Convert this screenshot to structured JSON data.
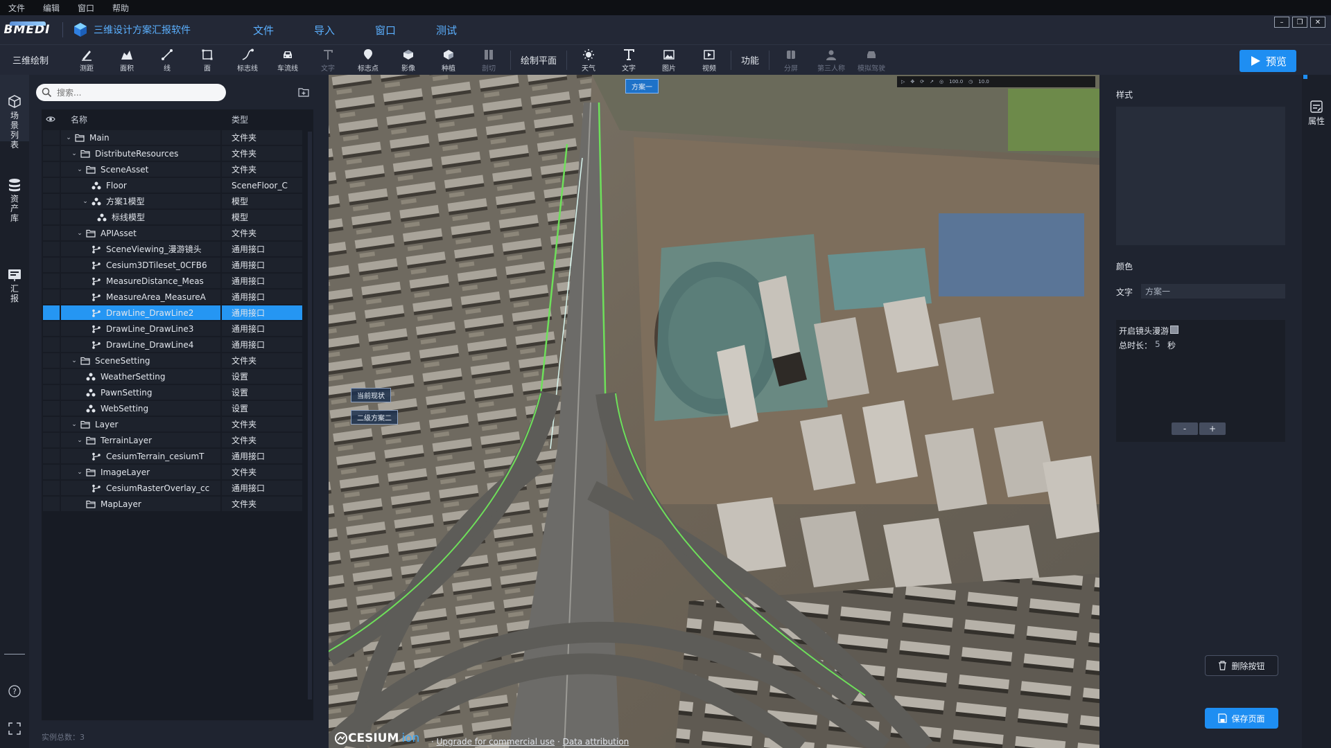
{
  "menubar": {
    "items": [
      "文件",
      "编辑",
      "窗口",
      "帮助"
    ]
  },
  "titlebar": {
    "logo": "BMEDI",
    "app_title": "三维设计方案汇报软件",
    "menus": [
      "文件",
      "导入",
      "窗口",
      "测试"
    ]
  },
  "toolbar": {
    "section_title": "三维绘制",
    "tools": [
      {
        "label": "测距",
        "icon": "ruler-icon",
        "enabled": true
      },
      {
        "label": "面积",
        "icon": "area-icon",
        "enabled": true
      },
      {
        "label": "线",
        "icon": "line-icon",
        "enabled": true
      },
      {
        "label": "面",
        "icon": "polygon-icon",
        "enabled": true
      },
      {
        "label": "标志线",
        "icon": "marker-line-icon",
        "enabled": true
      },
      {
        "label": "车流线",
        "icon": "car-icon",
        "enabled": true
      },
      {
        "label": "文字",
        "icon": "text-icon",
        "enabled": false
      },
      {
        "label": "标志点",
        "icon": "pin-icon",
        "enabled": true
      },
      {
        "label": "影像",
        "icon": "image-layer-icon",
        "enabled": true
      },
      {
        "label": "种植",
        "icon": "plant-icon",
        "enabled": true
      },
      {
        "label": "剖切",
        "icon": "section-icon",
        "enabled": false
      }
    ],
    "plane_label": "绘制平面",
    "tools2": [
      {
        "label": "天气",
        "icon": "weather-icon",
        "enabled": true
      },
      {
        "label": "文字",
        "icon": "text-icon",
        "enabled": true
      },
      {
        "label": "图片",
        "icon": "picture-icon",
        "enabled": true
      },
      {
        "label": "视频",
        "icon": "video-icon",
        "enabled": true
      }
    ],
    "function_label": "功能",
    "tools3": [
      {
        "label": "分屏",
        "icon": "split-screen-icon",
        "enabled": false
      },
      {
        "label": "第三人称",
        "icon": "person-icon",
        "enabled": false
      },
      {
        "label": "模拟驾驶",
        "icon": "drive-icon",
        "enabled": false
      }
    ],
    "preview_label": "预览"
  },
  "leftrail": {
    "items": [
      {
        "label": "场景列表",
        "icon": "scene-list-icon"
      },
      {
        "label": "资产库",
        "icon": "asset-library-icon"
      },
      {
        "label": "汇报",
        "icon": "report-icon"
      }
    ]
  },
  "tree": {
    "search_placeholder": "搜索...",
    "col_name": "名称",
    "col_type": "类型",
    "rows": [
      {
        "name": "Main",
        "type": "文件夹",
        "depth": 0,
        "kind": "folder",
        "expanded": true
      },
      {
        "name": "DistributeResources",
        "type": "文件夹",
        "depth": 1,
        "kind": "folder",
        "expanded": true
      },
      {
        "name": "SceneAsset",
        "type": "文件夹",
        "depth": 2,
        "kind": "folder",
        "expanded": true
      },
      {
        "name": "Floor",
        "type": "SceneFloor_C",
        "depth": 3,
        "kind": "model"
      },
      {
        "name": "方案1模型",
        "type": "模型",
        "depth": 3,
        "kind": "model",
        "expanded": true
      },
      {
        "name": "标线模型",
        "type": "模型",
        "depth": 4,
        "kind": "model"
      },
      {
        "name": "APIAsset",
        "type": "文件夹",
        "depth": 2,
        "kind": "folder",
        "expanded": true
      },
      {
        "name": "SceneViewing_漫游镜头",
        "type": "通用接口",
        "depth": 3,
        "kind": "api"
      },
      {
        "name": "Cesium3DTileset_0CFB6",
        "type": "通用接口",
        "depth": 3,
        "kind": "api"
      },
      {
        "name": "MeasureDistance_Meas",
        "type": "通用接口",
        "depth": 3,
        "kind": "api"
      },
      {
        "name": "MeasureArea_MeasureA",
        "type": "通用接口",
        "depth": 3,
        "kind": "api"
      },
      {
        "name": "DrawLine_DrawLine2",
        "type": "通用接口",
        "depth": 3,
        "kind": "api",
        "selected": true
      },
      {
        "name": "DrawLine_DrawLine3",
        "type": "通用接口",
        "depth": 3,
        "kind": "api"
      },
      {
        "name": "DrawLine_DrawLine4",
        "type": "通用接口",
        "depth": 3,
        "kind": "api"
      },
      {
        "name": "SceneSetting",
        "type": "文件夹",
        "depth": 1,
        "kind": "folder",
        "expanded": true
      },
      {
        "name": "WeatherSetting",
        "type": "设置",
        "depth": 2,
        "kind": "model"
      },
      {
        "name": "PawnSetting",
        "type": "设置",
        "depth": 2,
        "kind": "model"
      },
      {
        "name": "WebSetting",
        "type": "设置",
        "depth": 2,
        "kind": "model"
      },
      {
        "name": "Layer",
        "type": "文件夹",
        "depth": 1,
        "kind": "folder",
        "expanded": true
      },
      {
        "name": "TerrainLayer",
        "type": "文件夹",
        "depth": 2,
        "kind": "folder",
        "expanded": true
      },
      {
        "name": "CesiumTerrain_cesiumT",
        "type": "通用接口",
        "depth": 3,
        "kind": "api"
      },
      {
        "name": "ImageLayer",
        "type": "文件夹",
        "depth": 2,
        "kind": "folder",
        "expanded": true
      },
      {
        "name": "CesiumRasterOverlay_cc",
        "type": "通用接口",
        "depth": 3,
        "kind": "api"
      },
      {
        "name": "MapLayer",
        "type": "文件夹",
        "depth": 2,
        "kind": "folder",
        "expanded": false
      }
    ],
    "footer": "实例总数：3"
  },
  "viewport": {
    "labels": [
      "方案一",
      "当前现状",
      "二级方案二"
    ],
    "toolbar_values": [
      "100.0",
      "10.0"
    ],
    "cesium_brand": "CESIUM",
    "cesium_ion": "ion",
    "credit_upgrade": "Upgrade for commercial use",
    "credit_attribution": "Data attribution"
  },
  "props": {
    "style_label": "样式",
    "color_label": "颜色",
    "text_label": "文字",
    "text_value": "方案一",
    "roam_label": "开启镜头漫游",
    "roam_enabled": false,
    "duration_label": "总时长：",
    "duration_value": "5",
    "duration_unit": "秒",
    "minus": "-",
    "plus": "+",
    "delete_label": "删除按钮",
    "save_label": "保存页面"
  },
  "rightrail": {
    "label": "属性"
  },
  "colors": {
    "accent": "#1e8ef2",
    "selected_row": "#2596f3",
    "panel": "#1f2430",
    "text_blue": "#5bb0ff"
  }
}
